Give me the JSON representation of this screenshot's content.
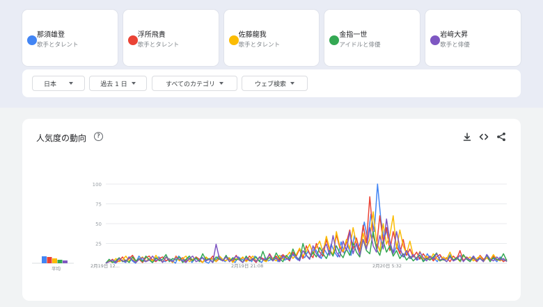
{
  "terms": [
    {
      "name": "那須雄登",
      "category": "歌手とタレント",
      "color": "#4285f4"
    },
    {
      "name": "浮所飛貴",
      "category": "歌手とタレント",
      "color": "#ea4335"
    },
    {
      "name": "佐藤龍我",
      "category": "歌手とタレント",
      "color": "#fbbc04"
    },
    {
      "name": "金指一世",
      "category": "アイドルと俳優",
      "color": "#34a853"
    },
    {
      "name": "岩﨑大昇",
      "category": "歌手と俳優",
      "color": "#7e57c2"
    }
  ],
  "filters": {
    "region": "日本",
    "time": "過去 1 日",
    "category": "すべてのカテゴリ",
    "search_type": "ウェブ検索"
  },
  "chart": {
    "title": "人気度の動向",
    "average_label": "平均"
  },
  "chart_data": {
    "type": "line",
    "y_ticks": [
      "100",
      "75",
      "50",
      "25"
    ],
    "ylim": [
      0,
      100
    ],
    "x_tick_labels": [
      "2月19日 12...",
      "2月19日 21:08",
      "2月20日 5:32"
    ],
    "grid": true,
    "averages": [
      {
        "name": "那須雄登",
        "value": 10
      },
      {
        "name": "浮所飛貴",
        "value": 9
      },
      {
        "name": "佐藤龍我",
        "value": 7
      },
      {
        "name": "金指一世",
        "value": 5
      },
      {
        "name": "岩﨑大昇",
        "value": 4
      }
    ],
    "series": [
      {
        "name": "那須雄登",
        "values": [
          0,
          4,
          2,
          0,
          6,
          3,
          1,
          8,
          3,
          0,
          9,
          4,
          2,
          6,
          1,
          5,
          8,
          3,
          2,
          6,
          4,
          0,
          9,
          5,
          3,
          7,
          1,
          6,
          4,
          8,
          2,
          0,
          6,
          3,
          9,
          5,
          2,
          7,
          4,
          1,
          8,
          5,
          3,
          6,
          2,
          9,
          4,
          1,
          7,
          3,
          5,
          8,
          2,
          10,
          4,
          6,
          13,
          8,
          4,
          11,
          7,
          15,
          9,
          20,
          12,
          6,
          17,
          10,
          24,
          14,
          8,
          27,
          12,
          22,
          10,
          35,
          18,
          28,
          52,
          30,
          62,
          40,
          100,
          55,
          30,
          45,
          20,
          14,
          25,
          10,
          8,
          15,
          6,
          10,
          4,
          8,
          3,
          12,
          5,
          7,
          2,
          9,
          4,
          6,
          11,
          3,
          8,
          2,
          10,
          5,
          4,
          9,
          2,
          7,
          3,
          11,
          5,
          6,
          2,
          8,
          4,
          3
        ]
      },
      {
        "name": "浮所飛貴",
        "values": [
          0,
          2,
          5,
          1,
          3,
          8,
          2,
          6,
          10,
          3,
          5,
          1,
          7,
          9,
          4,
          2,
          6,
          8,
          3,
          5,
          1,
          9,
          4,
          7,
          2,
          6,
          3,
          8,
          5,
          1,
          7,
          4,
          9,
          2,
          6,
          3,
          8,
          5,
          2,
          10,
          4,
          7,
          3,
          9,
          5,
          1,
          8,
          6,
          3,
          12,
          5,
          9,
          4,
          11,
          7,
          3,
          14,
          9,
          18,
          6,
          22,
          12,
          7,
          25,
          14,
          9,
          30,
          16,
          11,
          36,
          20,
          14,
          26,
          42,
          18,
          32,
          15,
          48,
          26,
          84,
          35,
          20,
          60,
          28,
          45,
          16,
          40,
          22,
          12,
          30,
          10,
          18,
          8,
          14,
          5,
          12,
          6,
          9,
          3,
          8,
          11,
          4,
          7,
          2,
          9,
          5,
          16,
          3,
          8,
          4,
          6,
          2,
          10,
          5,
          7,
          3,
          9,
          4,
          6,
          2,
          5
        ]
      },
      {
        "name": "佐藤龍我",
        "values": [
          0,
          3,
          1,
          6,
          2,
          4,
          9,
          3,
          7,
          1,
          5,
          8,
          2,
          6,
          3,
          10,
          4,
          2,
          7,
          5,
          1,
          8,
          3,
          6,
          9,
          2,
          5,
          7,
          3,
          1,
          8,
          4,
          6,
          2,
          9,
          5,
          3,
          7,
          1,
          6,
          4,
          8,
          2,
          5,
          9,
          3,
          7,
          4,
          2,
          8,
          6,
          3,
          10,
          5,
          8,
          14,
          6,
          11,
          19,
          9,
          15,
          24,
          12,
          20,
          28,
          14,
          34,
          18,
          10,
          40,
          22,
          15,
          30,
          18,
          45,
          25,
          12,
          38,
          20,
          30,
          65,
          28,
          15,
          50,
          24,
          35,
          60,
          18,
          42,
          22,
          12,
          28,
          10,
          6,
          15,
          5,
          9,
          4,
          12,
          6,
          3,
          8,
          5,
          14,
          4,
          7,
          2,
          10,
          5,
          8,
          3,
          6,
          9,
          2,
          7,
          4,
          11,
          5,
          3,
          6,
          2
        ]
      },
      {
        "name": "金指一世",
        "values": [
          0,
          5,
          1,
          3,
          7,
          2,
          4,
          1,
          8,
          3,
          6,
          2,
          9,
          4,
          1,
          7,
          3,
          5,
          11,
          2,
          6,
          4,
          8,
          1,
          5,
          9,
          3,
          7,
          2,
          12,
          4,
          6,
          1,
          8,
          5,
          3,
          10,
          2,
          7,
          4,
          6,
          1,
          9,
          3,
          5,
          8,
          2,
          15,
          4,
          7,
          3,
          13,
          6,
          2,
          10,
          5,
          18,
          8,
          4,
          25,
          10,
          6,
          14,
          8,
          20,
          12,
          6,
          16,
          9,
          22,
          13,
          7,
          18,
          10,
          26,
          14,
          8,
          30,
          16,
          12,
          40,
          18,
          10,
          28,
          14,
          22,
          9,
          16,
          6,
          12,
          4,
          9,
          3,
          7,
          10,
          2,
          6,
          4,
          8,
          13,
          3,
          5,
          2,
          9,
          4,
          7,
          3,
          11,
          5,
          2,
          8,
          4,
          6,
          3,
          10,
          2,
          7,
          5,
          4,
          12,
          3
        ]
      },
      {
        "name": "岩﨑大昇",
        "values": [
          0,
          2,
          4,
          1,
          6,
          3,
          2,
          8,
          4,
          1,
          5,
          7,
          2,
          4,
          9,
          3,
          6,
          1,
          8,
          4,
          2,
          7,
          5,
          3,
          1,
          6,
          9,
          2,
          4,
          7,
          3,
          5,
          1,
          24,
          6,
          3,
          8,
          2,
          5,
          9,
          4,
          1,
          7,
          3,
          6,
          2,
          8,
          4,
          5,
          11,
          3,
          7,
          2,
          9,
          6,
          4,
          12,
          8,
          3,
          16,
          10,
          5,
          22,
          12,
          7,
          18,
          24,
          10,
          35,
          14,
          8,
          28,
          16,
          40,
          12,
          25,
          10,
          30,
          18,
          45,
          22,
          14,
          35,
          18,
          56,
          28,
          12,
          40,
          20,
          8,
          16,
          6,
          11,
          4,
          14,
          7,
          3,
          9,
          5,
          12,
          4,
          6,
          2,
          8,
          3,
          5,
          10,
          2,
          7,
          4,
          9,
          3,
          6,
          2,
          11,
          5,
          3,
          8,
          4,
          6,
          2
        ]
      }
    ]
  }
}
